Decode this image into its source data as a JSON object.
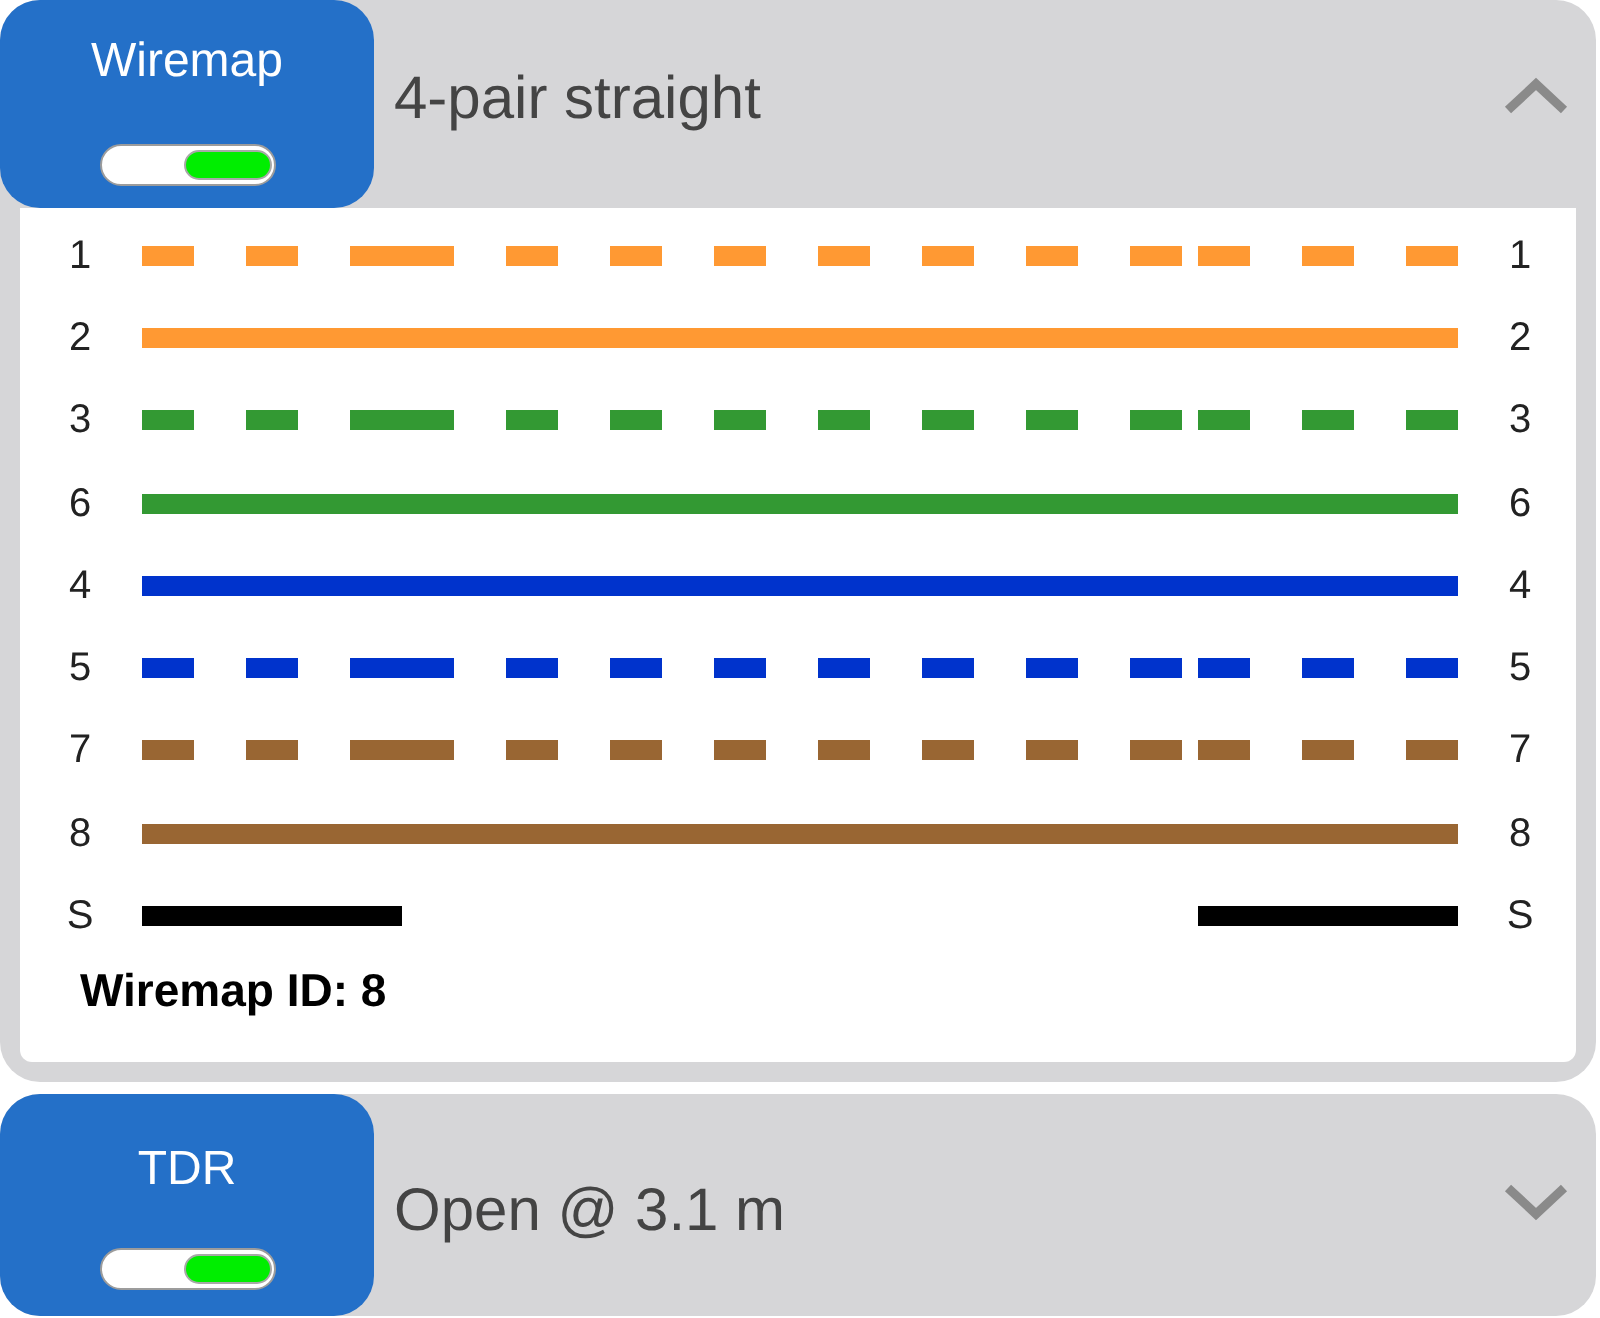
{
  "panels": [
    {
      "title": "Wiremap",
      "toggle_on": true,
      "summary": "4-pair straight",
      "expanded": true,
      "wires": [
        {
          "left_pin": "1",
          "right_pin": "1",
          "kind": "dashed",
          "color": "#ff9933"
        },
        {
          "left_pin": "2",
          "right_pin": "2",
          "kind": "solid",
          "color": "#ff9933"
        },
        {
          "left_pin": "3",
          "right_pin": "3",
          "kind": "dashed",
          "color": "#339933"
        },
        {
          "left_pin": "6",
          "right_pin": "6",
          "kind": "solid",
          "color": "#339933"
        },
        {
          "left_pin": "4",
          "right_pin": "4",
          "kind": "solid",
          "color": "#0033cc"
        },
        {
          "left_pin": "5",
          "right_pin": "5",
          "kind": "dashed",
          "color": "#0033cc"
        },
        {
          "left_pin": "7",
          "right_pin": "7",
          "kind": "dashed",
          "color": "#996633"
        },
        {
          "left_pin": "8",
          "right_pin": "8",
          "kind": "solid",
          "color": "#996633"
        },
        {
          "left_pin": "S",
          "right_pin": "S",
          "kind": "split",
          "color": "#000000"
        }
      ],
      "footer": "Wiremap ID: 8"
    },
    {
      "title": "TDR",
      "toggle_on": true,
      "summary": "Open @ 3.1 m",
      "expanded": false
    }
  ]
}
